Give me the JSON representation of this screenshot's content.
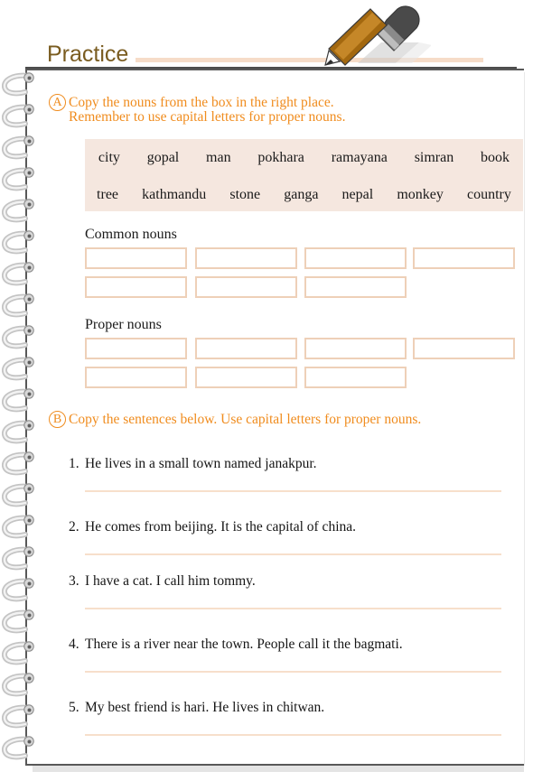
{
  "header": {
    "title": "Practice",
    "pencil_icon": "pencil-icon"
  },
  "exercises": [
    {
      "marker": "A",
      "instruction_line1": "Copy the nouns from the box in the right place.",
      "instruction_line2": "Remember to use capital letters for proper nouns."
    },
    {
      "marker": "B",
      "instruction_line1": "Copy the sentences below. Use capital letters for proper nouns."
    }
  ],
  "word_bank": {
    "row1": [
      "city",
      "gopal",
      "man",
      "pokhara",
      "ramayana",
      "simran",
      "book"
    ],
    "row2": [
      "tree",
      "kathmandu",
      "stone",
      "ganga",
      "nepal",
      "monkey",
      "country"
    ]
  },
  "categories": [
    {
      "label": "Common nouns",
      "row1_boxes": 4,
      "row2_boxes": 3
    },
    {
      "label": "Proper nouns",
      "row1_boxes": 4,
      "row2_boxes": 3
    }
  ],
  "sentences": [
    {
      "number": "1.",
      "text": "He lives in a small town named janakpur."
    },
    {
      "number": "2.",
      "text": "He comes from beijing. It is the capital of china."
    },
    {
      "number": "3.",
      "text": "I have a cat. I call him tommy."
    },
    {
      "number": "4.",
      "text": "There is a river near the town. People call it the bagmati."
    },
    {
      "number": "5.",
      "text": "My best friend is hari. He lives in chitwan."
    }
  ],
  "colors": {
    "title": "#7a5c20",
    "accent_orange": "#f08c1e",
    "peach_rule": "#f6dcc8",
    "box_border": "#eed0b8",
    "word_box_bg": "#f5e7df",
    "page_border": "#585858"
  }
}
